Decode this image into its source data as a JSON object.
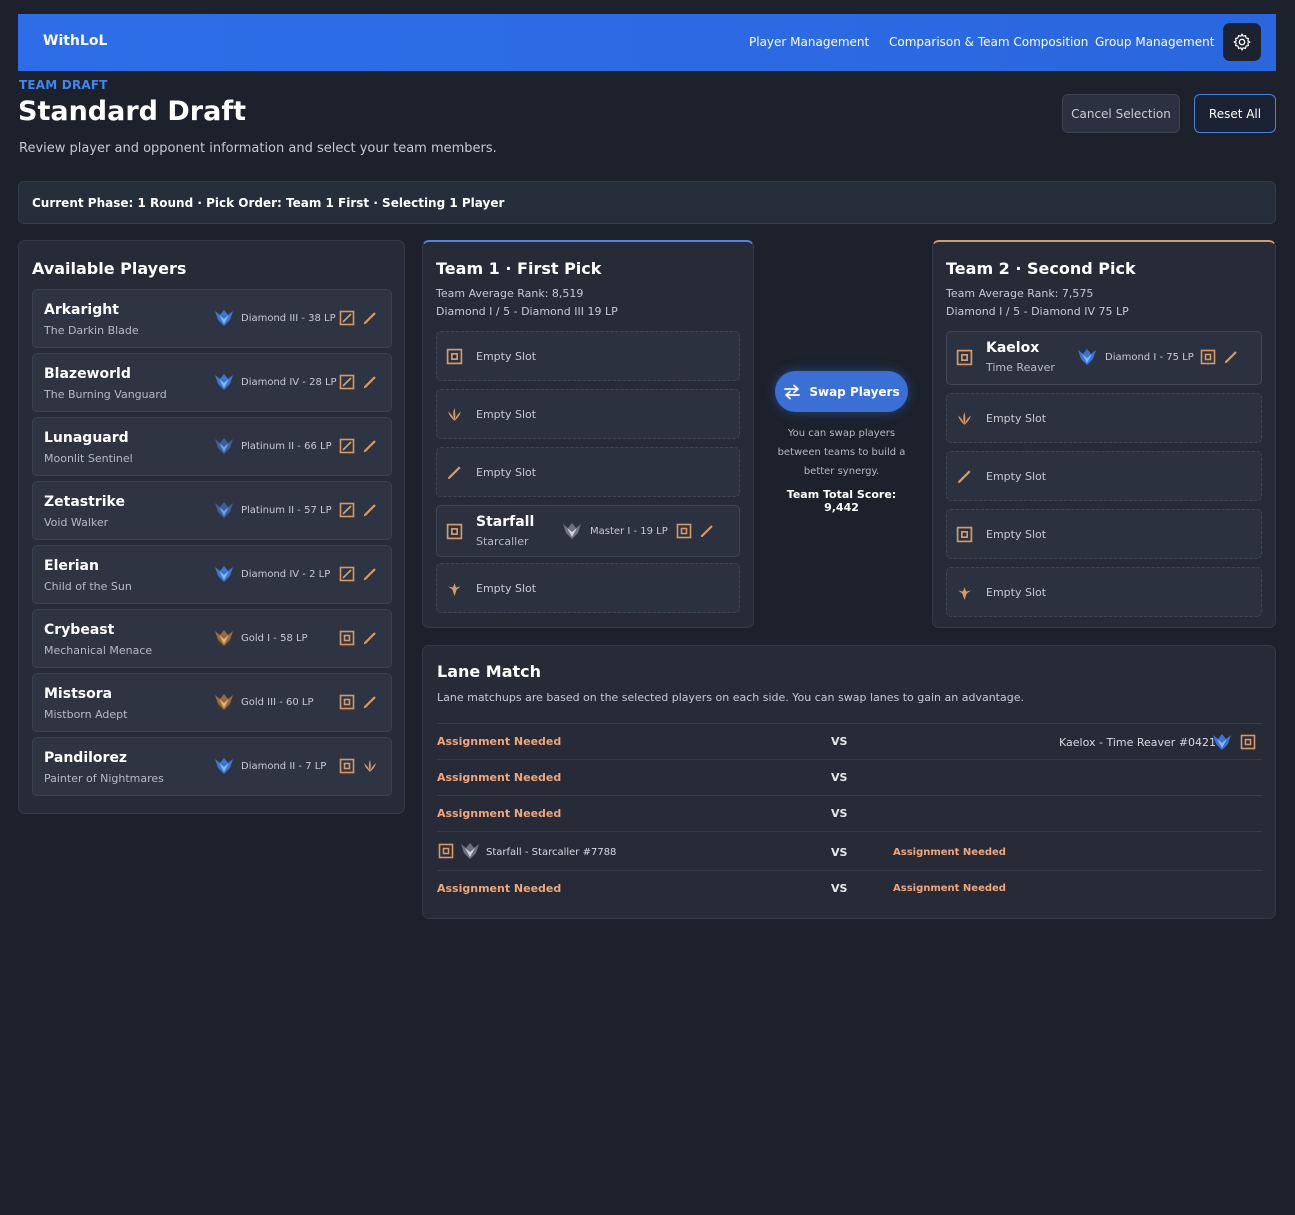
{
  "app": {
    "brand": "WithLoL",
    "nav": [
      "Player Management",
      "Comparison & Team Composition",
      "Group Management"
    ]
  },
  "header": {
    "eyebrow": "TEAM DRAFT",
    "title": "Standard Draft",
    "subtitle": "Review player and opponent information and select your team members.",
    "cancel_label": "Cancel Selection",
    "reset_label": "Reset All"
  },
  "phase": "Current Phase: 1 Round · Pick Order: Team 1 First · Selecting 1 Player",
  "available": {
    "title": "Available Players",
    "players": [
      {
        "name": "Arkaright",
        "title": "The Darkin Blade",
        "rank": "Diamond III - 38 LP",
        "tier": "diamond",
        "roles": [
          "mid-icon",
          "top-icon"
        ]
      },
      {
        "name": "Blazeworld",
        "title": "The Burning Vanguard",
        "rank": "Diamond IV - 28 LP",
        "tier": "diamond",
        "roles": [
          "mid-icon",
          "top-icon"
        ]
      },
      {
        "name": "Lunaguard",
        "title": "Moonlit Sentinel",
        "rank": "Platinum II - 66 LP",
        "tier": "platinum",
        "roles": [
          "mid-icon",
          "top-icon"
        ]
      },
      {
        "name": "Zetastrike",
        "title": "Void Walker",
        "rank": "Platinum II - 57 LP",
        "tier": "platinum",
        "roles": [
          "mid-icon",
          "top-icon"
        ]
      },
      {
        "name": "Elerian",
        "title": "Child of the Sun",
        "rank": "Diamond IV - 2 LP",
        "tier": "diamond",
        "roles": [
          "mid-icon",
          "top-icon"
        ]
      },
      {
        "name": "Crybeast",
        "title": "Mechanical Menace",
        "rank": "Gold I - 58 LP",
        "tier": "gold",
        "roles": [
          "bot-icon",
          "top-icon"
        ]
      },
      {
        "name": "Mistsora",
        "title": "Mistborn Adept",
        "rank": "Gold III - 60 LP",
        "tier": "gold",
        "roles": [
          "bot-icon",
          "top-icon"
        ]
      },
      {
        "name": "Pandilorez",
        "title": "Painter of Nightmares",
        "rank": "Diamond II - 7 LP",
        "tier": "diamond",
        "roles": [
          "bot-icon",
          "jungle-icon"
        ]
      }
    ]
  },
  "team1": {
    "title": "Team 1 · First Pick",
    "avg_rank": "Team Average Rank: 8,519",
    "range": "Diamond I / 5 - Diamond III 19 LP",
    "slots": [
      {
        "role": "bot-icon",
        "label": "Empty Slot"
      },
      {
        "role": "jungle-icon",
        "label": "Empty Slot"
      },
      {
        "role": "top-icon",
        "label": "Empty Slot"
      },
      {
        "role": "bot-icon",
        "filled": true,
        "name": "Starfall",
        "title": "Starcaller",
        "rank": "Master I - 19 LP"
      },
      {
        "role": "support-icon",
        "label": "Empty Slot"
      }
    ]
  },
  "team2": {
    "title": "Team 2 · Second Pick",
    "avg_rank": "Team Average Rank: 7,575",
    "range": "Diamond I / 5 - Diamond IV 75 LP",
    "slots": [
      {
        "role": "bot-icon",
        "filled": true,
        "name": "Kaelox",
        "title": "Time Reaver",
        "rank": "Diamond I - 75 LP"
      },
      {
        "role": "jungle-icon",
        "label": "Empty Slot"
      },
      {
        "role": "top-icon",
        "label": "Empty Slot"
      },
      {
        "role": "bot-icon",
        "label": "Empty Slot"
      },
      {
        "role": "support-icon",
        "label": "Empty Slot"
      }
    ]
  },
  "swap": {
    "label": "Swap Players",
    "help": "You can swap players between teams to build a better synergy.",
    "score": "Team Total Score: 9,442"
  },
  "lane": {
    "title": "Lane Match",
    "desc": "Lane matchups are based on the selected players on each side. You can swap lanes to gain an advantage.",
    "vs": "VS",
    "need": "Assignment Needed",
    "kaelox": "Kaelox - Time Reaver #0421",
    "starfall": "Starfall - Starcaller #7788"
  },
  "colors": {
    "accent": "#2d6ee8",
    "diamond": "#4a86e8",
    "gold": "#c9905a",
    "role": "#d49a6a",
    "warning": "#f0a67a"
  }
}
